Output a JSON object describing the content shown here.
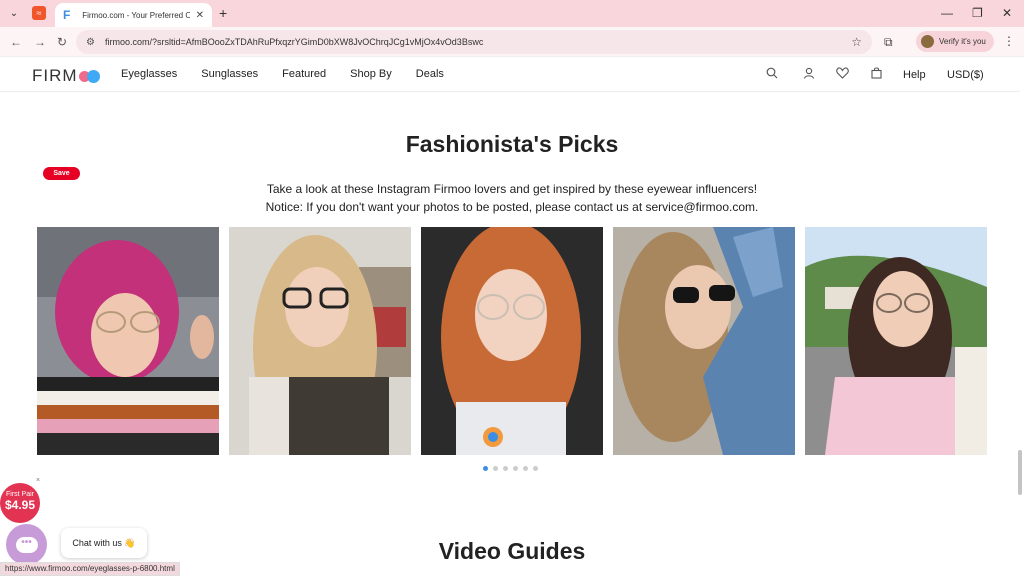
{
  "browser": {
    "tab_title": "Firmoo.com - Your Preferred O",
    "url": "firmoo.com/?srsltid=AfmBOooZxTDAhRuPfxqzrYGimD0bXW8JvOChrqJCg1vMjOx4vOd3Bswc",
    "verify_label": "Verify it's you",
    "status_url": "https://www.firmoo.com/eyeglasses-p-6800.html"
  },
  "site": {
    "logo": "FIRM",
    "nav": [
      "Eyeglasses",
      "Sunglasses",
      "Featured",
      "Shop By",
      "Deals"
    ],
    "help": "Help",
    "currency": "USD($)"
  },
  "section": {
    "title": "Fashionista's Picks",
    "save_badge": "Save",
    "intro_line1": "Take a look at these Instagram Firmoo lovers and get inspired by these eyewear influencers!",
    "intro_line2": "Notice: If you don't want your photos to be posted, please contact us at service@firmoo.com.",
    "photo_count": 6,
    "active_photo_index": 0
  },
  "widgets": {
    "promo_label": "First Pair",
    "promo_price": "$4.95",
    "chat_label": "Chat with us 👋"
  },
  "video_section": {
    "title": "Video Guides"
  },
  "colors": {
    "accent": "#3a8ee6",
    "promo": "#e23452",
    "pinterest": "#e60023"
  }
}
